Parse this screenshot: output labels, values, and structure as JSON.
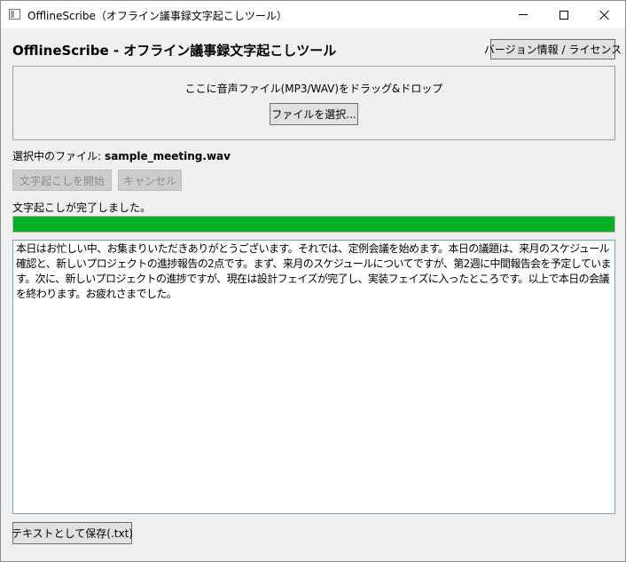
{
  "window": {
    "title": "OfflineScribe（オフライン議事録文字起こしツール）"
  },
  "header": {
    "title": "OfflineScribe - オフライン議事録文字起こしツール",
    "version_button": "バージョン情報 / ライセンス"
  },
  "dropzone": {
    "instruction": "ここに音声ファイル(MP3/WAV)をドラッグ&ドロップ",
    "select_button": "ファイルを選択..."
  },
  "file": {
    "label": "選択中のファイル:",
    "name": "sample_meeting.wav"
  },
  "actions": {
    "start_button": "文字起こしを開始",
    "cancel_button": "キャンセル"
  },
  "status": {
    "message": "文字起こしが完了しました。",
    "progress_percent": 100
  },
  "transcript": {
    "text": "本日はお忙しい中、お集まりいただきありがとうございます。それでは、定例会議を始めます。本日の議題は、来月のスケジュール確認と、新しいプロジェクトの進捗報告の2点です。まず、来月のスケジュールについてですが、第2週に中間報告会を予定しています。次に、新しいプロジェクトの進捗ですが、現在は設計フェイズが完了し、実装フェイズに入ったところです。以上で本日の会議を終わります。お疲れさまでした。"
  },
  "footer": {
    "save_button": "テキストとして保存(.txt)"
  },
  "colors": {
    "progress_fill": "#06b025",
    "window_bg": "#f0f0f0"
  }
}
